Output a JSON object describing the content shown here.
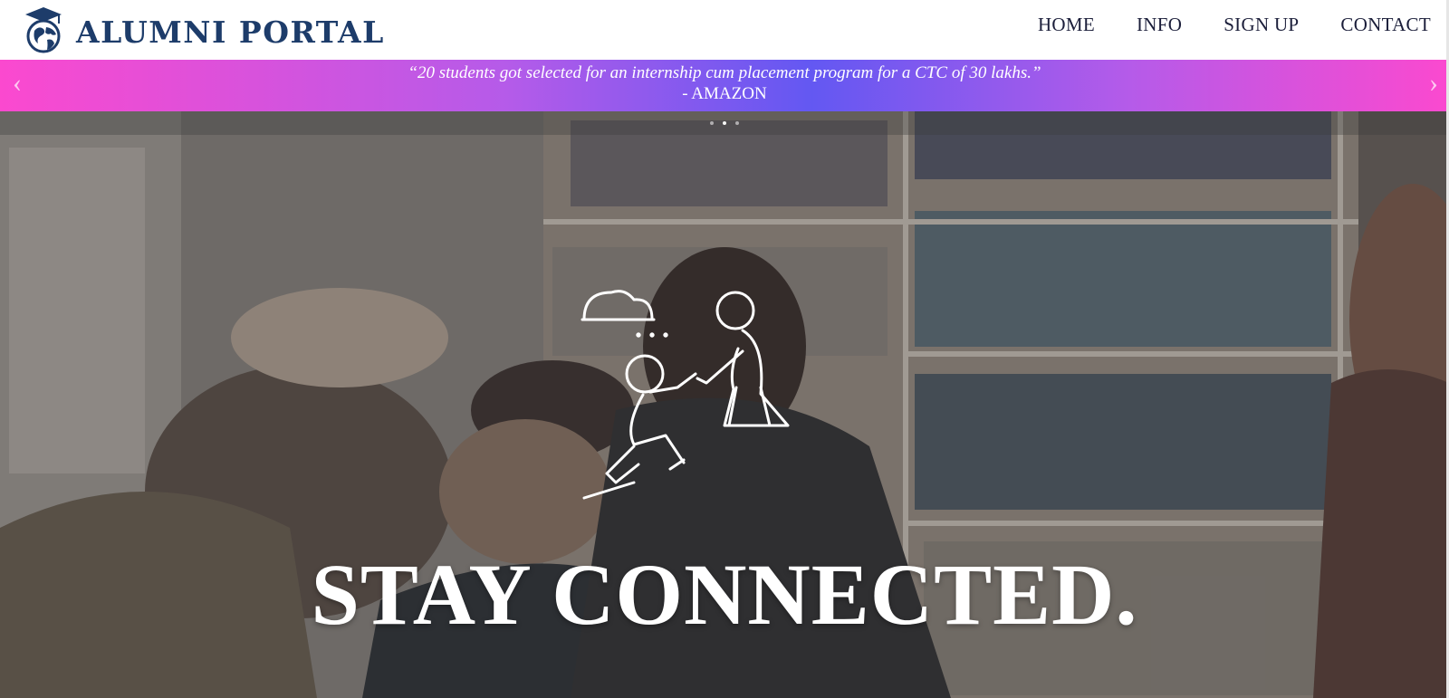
{
  "header": {
    "brand": "ALUMNI PORTAL",
    "logo_icon": "graduation-globe-icon",
    "brand_color": "#1d3c6a",
    "nav": [
      "HOME",
      "INFO",
      "SIGN UP",
      "CONTACT"
    ]
  },
  "banner": {
    "quote": "“20 students got selected for an internship cum placement program for a CTC of 30 lakhs.”",
    "source": "- AMAZON",
    "prev_icon": "chevron-left-icon",
    "next_icon": "chevron-right-icon",
    "prev_glyph": "‹",
    "next_glyph": "›",
    "colors": [
      "#fb49cf",
      "#6358f2"
    ],
    "slide_count": 3,
    "active_slide": 2
  },
  "hero": {
    "icon": "helping-hand-climb-icon",
    "title": "STAY CONNECTED."
  }
}
